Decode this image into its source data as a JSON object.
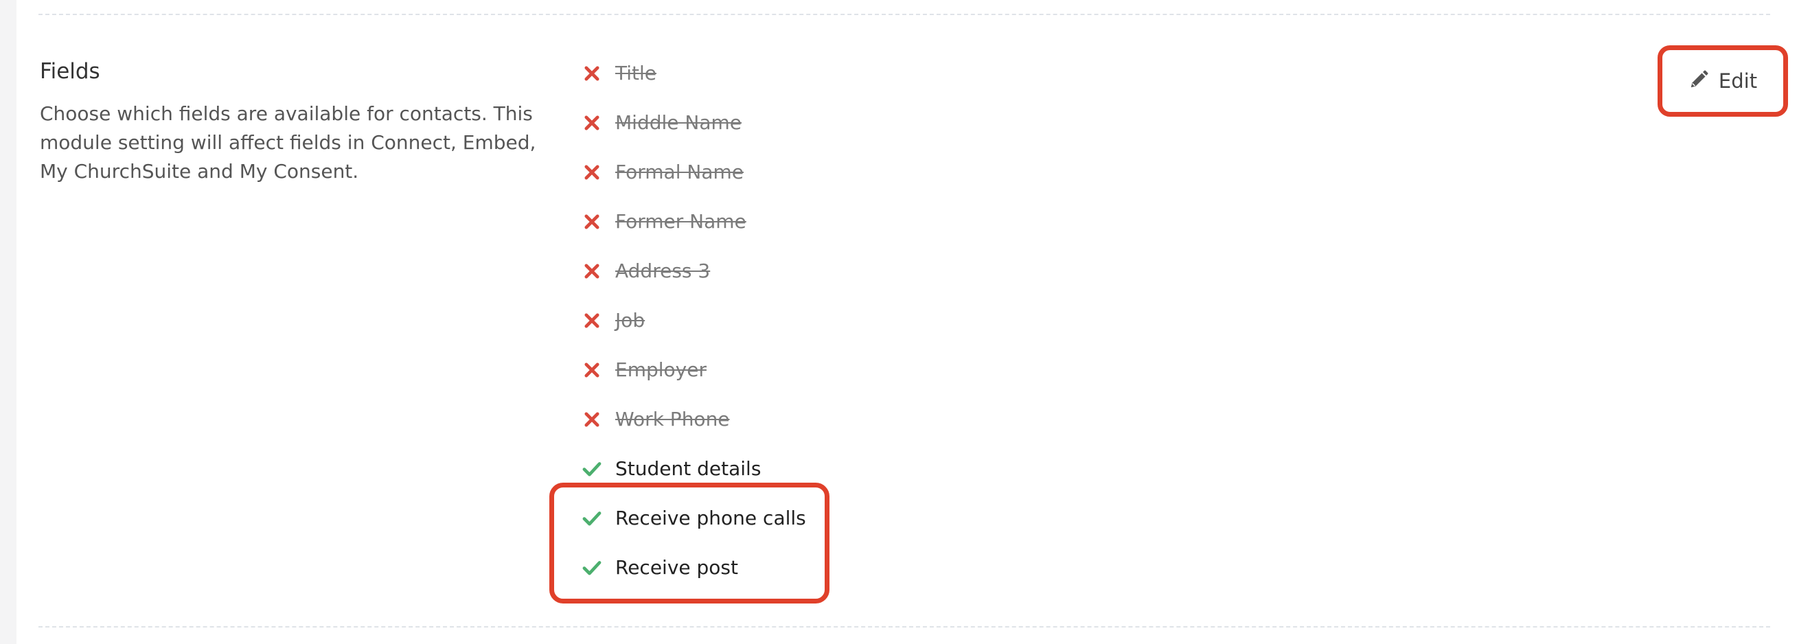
{
  "section": {
    "title": "Fields",
    "description": "Choose which fields are available for contacts. This module setting will affect fields in Connect, Embed, My ChurchSuite and My Consent."
  },
  "edit_button": {
    "label": "Edit",
    "icon": "pencil-icon"
  },
  "fields": [
    {
      "label": "Title",
      "enabled": false,
      "icon": "cross-icon"
    },
    {
      "label": "Middle Name",
      "enabled": false,
      "icon": "cross-icon"
    },
    {
      "label": "Formal Name",
      "enabled": false,
      "icon": "cross-icon"
    },
    {
      "label": "Former Name",
      "enabled": false,
      "icon": "cross-icon"
    },
    {
      "label": "Address 3",
      "enabled": false,
      "icon": "cross-icon"
    },
    {
      "label": "Job",
      "enabled": false,
      "icon": "cross-icon"
    },
    {
      "label": "Employer",
      "enabled": false,
      "icon": "cross-icon"
    },
    {
      "label": "Work Phone",
      "enabled": false,
      "icon": "cross-icon"
    },
    {
      "label": "Student details",
      "enabled": true,
      "icon": "check-icon"
    },
    {
      "label": "Receive phone calls",
      "enabled": true,
      "icon": "check-icon"
    },
    {
      "label": "Receive post",
      "enabled": true,
      "icon": "check-icon"
    }
  ],
  "colors": {
    "disabled_icon": "#d9483b",
    "enabled_icon": "#4caf6e",
    "annotation_outline": "#e0402a"
  }
}
